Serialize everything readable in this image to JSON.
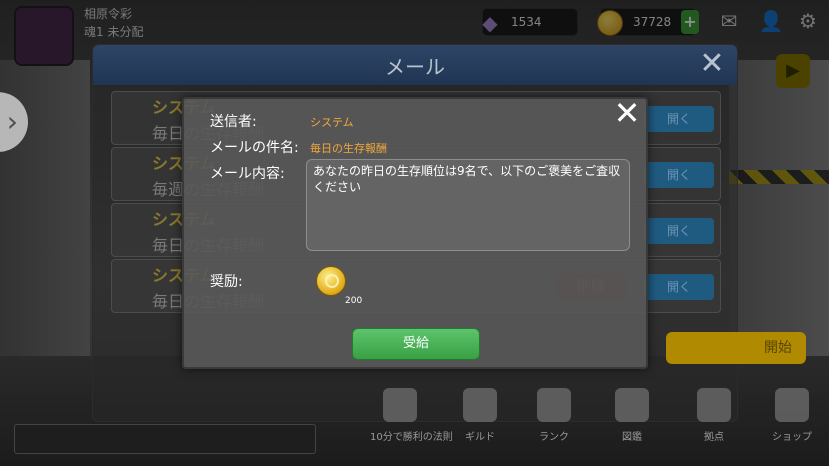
{
  "hud": {
    "player_name": "相原令彩",
    "player_sub": "魂1 未分配",
    "gems": "1534",
    "coins": "37728",
    "plus_label": "+",
    "mail_icon": "mail-icon",
    "friend_icon": "friend-icon",
    "gear_icon": "gear-icon"
  },
  "mail_window": {
    "title": "メール",
    "close_label": "✕",
    "items": [
      {
        "sender": "システム",
        "subject": "毎日の生存報酬",
        "delete_label": "削除",
        "open_label": "開く"
      },
      {
        "sender": "システム",
        "subject": "毎週の生存報酬",
        "delete_label": "削除",
        "open_label": "開く"
      },
      {
        "sender": "システム",
        "subject": "毎日の生存報酬",
        "delete_label": "削除",
        "open_label": "開く"
      },
      {
        "sender": "システム",
        "subject": "毎日の生存報酬",
        "delete_label": "削除",
        "open_label": "開く"
      }
    ]
  },
  "bottom_nav": {
    "items": [
      {
        "label": "10分で勝利の法則",
        "icon": "book-icon"
      },
      {
        "label": "ギルド",
        "icon": "guild-icon"
      },
      {
        "label": "ランク",
        "icon": "trophy-icon"
      },
      {
        "label": "図鑑",
        "icon": "book-icon"
      },
      {
        "label": "拠点",
        "icon": "home-icon"
      },
      {
        "label": "ショップ",
        "icon": "shop-icon"
      }
    ],
    "start_label": "開始"
  },
  "modal": {
    "close_label": "✕",
    "sender_label": "送信者:",
    "sender_value": "システム",
    "subject_label": "メールの件名:",
    "subject_value": "毎日の生存報酬",
    "content_label": "メール内容:",
    "content_value": "あなたの昨日の生存順位は9名で、以下のご褒美をご査収ください",
    "reward_label": "奨励:",
    "reward_count": "200",
    "reward_icon": "gold-coin-icon",
    "receive_label": "受給"
  },
  "colors": {
    "accent_orange": "#f2a93b",
    "receive_green": "#39a046",
    "header_blue": "#203553"
  }
}
